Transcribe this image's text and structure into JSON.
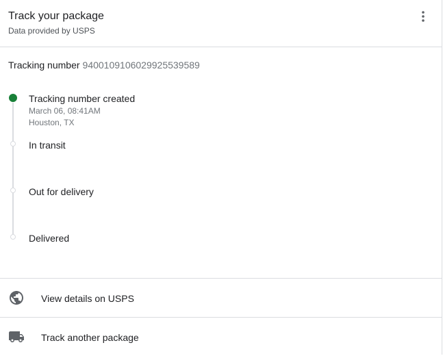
{
  "header": {
    "title": "Track your package",
    "subtitle": "Data provided by USPS",
    "menu_icon": "more-vert-icon"
  },
  "tracking": {
    "label": "Tracking number",
    "number": "9400109106029925539589"
  },
  "timeline": {
    "steps": [
      {
        "title": "Tracking number created",
        "date": "March 06, 08:41AM",
        "location": "Houston, TX",
        "status": "completed"
      },
      {
        "title": "In transit",
        "status": "pending"
      },
      {
        "title": "Out for delivery",
        "status": "pending"
      },
      {
        "title": "Delivered",
        "status": "pending"
      }
    ]
  },
  "actions": [
    {
      "label": "View details on USPS",
      "icon": "globe-icon"
    },
    {
      "label": "Track another package",
      "icon": "truck-icon"
    }
  ],
  "colors": {
    "active_dot": "#188038",
    "divider": "#dadce0",
    "secondary_text": "#70757a"
  }
}
